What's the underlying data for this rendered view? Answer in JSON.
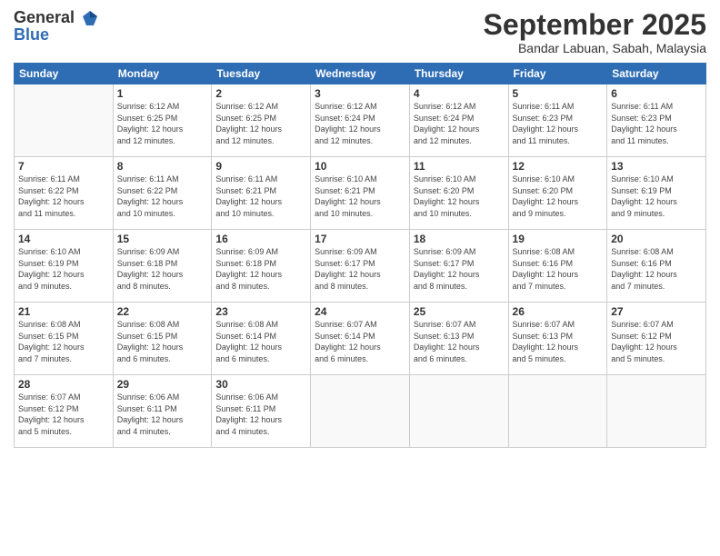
{
  "header": {
    "logo_general": "General",
    "logo_blue": "Blue",
    "month_title": "September 2025",
    "subtitle": "Bandar Labuan, Sabah, Malaysia"
  },
  "days_of_week": [
    "Sunday",
    "Monday",
    "Tuesday",
    "Wednesday",
    "Thursday",
    "Friday",
    "Saturday"
  ],
  "weeks": [
    [
      {
        "day": "",
        "info": ""
      },
      {
        "day": "1",
        "info": "Sunrise: 6:12 AM\nSunset: 6:25 PM\nDaylight: 12 hours\nand 12 minutes."
      },
      {
        "day": "2",
        "info": "Sunrise: 6:12 AM\nSunset: 6:25 PM\nDaylight: 12 hours\nand 12 minutes."
      },
      {
        "day": "3",
        "info": "Sunrise: 6:12 AM\nSunset: 6:24 PM\nDaylight: 12 hours\nand 12 minutes."
      },
      {
        "day": "4",
        "info": "Sunrise: 6:12 AM\nSunset: 6:24 PM\nDaylight: 12 hours\nand 12 minutes."
      },
      {
        "day": "5",
        "info": "Sunrise: 6:11 AM\nSunset: 6:23 PM\nDaylight: 12 hours\nand 11 minutes."
      },
      {
        "day": "6",
        "info": "Sunrise: 6:11 AM\nSunset: 6:23 PM\nDaylight: 12 hours\nand 11 minutes."
      }
    ],
    [
      {
        "day": "7",
        "info": "Sunrise: 6:11 AM\nSunset: 6:22 PM\nDaylight: 12 hours\nand 11 minutes."
      },
      {
        "day": "8",
        "info": "Sunrise: 6:11 AM\nSunset: 6:22 PM\nDaylight: 12 hours\nand 10 minutes."
      },
      {
        "day": "9",
        "info": "Sunrise: 6:11 AM\nSunset: 6:21 PM\nDaylight: 12 hours\nand 10 minutes."
      },
      {
        "day": "10",
        "info": "Sunrise: 6:10 AM\nSunset: 6:21 PM\nDaylight: 12 hours\nand 10 minutes."
      },
      {
        "day": "11",
        "info": "Sunrise: 6:10 AM\nSunset: 6:20 PM\nDaylight: 12 hours\nand 10 minutes."
      },
      {
        "day": "12",
        "info": "Sunrise: 6:10 AM\nSunset: 6:20 PM\nDaylight: 12 hours\nand 9 minutes."
      },
      {
        "day": "13",
        "info": "Sunrise: 6:10 AM\nSunset: 6:19 PM\nDaylight: 12 hours\nand 9 minutes."
      }
    ],
    [
      {
        "day": "14",
        "info": "Sunrise: 6:10 AM\nSunset: 6:19 PM\nDaylight: 12 hours\nand 9 minutes."
      },
      {
        "day": "15",
        "info": "Sunrise: 6:09 AM\nSunset: 6:18 PM\nDaylight: 12 hours\nand 8 minutes."
      },
      {
        "day": "16",
        "info": "Sunrise: 6:09 AM\nSunset: 6:18 PM\nDaylight: 12 hours\nand 8 minutes."
      },
      {
        "day": "17",
        "info": "Sunrise: 6:09 AM\nSunset: 6:17 PM\nDaylight: 12 hours\nand 8 minutes."
      },
      {
        "day": "18",
        "info": "Sunrise: 6:09 AM\nSunset: 6:17 PM\nDaylight: 12 hours\nand 8 minutes."
      },
      {
        "day": "19",
        "info": "Sunrise: 6:08 AM\nSunset: 6:16 PM\nDaylight: 12 hours\nand 7 minutes."
      },
      {
        "day": "20",
        "info": "Sunrise: 6:08 AM\nSunset: 6:16 PM\nDaylight: 12 hours\nand 7 minutes."
      }
    ],
    [
      {
        "day": "21",
        "info": "Sunrise: 6:08 AM\nSunset: 6:15 PM\nDaylight: 12 hours\nand 7 minutes."
      },
      {
        "day": "22",
        "info": "Sunrise: 6:08 AM\nSunset: 6:15 PM\nDaylight: 12 hours\nand 6 minutes."
      },
      {
        "day": "23",
        "info": "Sunrise: 6:08 AM\nSunset: 6:14 PM\nDaylight: 12 hours\nand 6 minutes."
      },
      {
        "day": "24",
        "info": "Sunrise: 6:07 AM\nSunset: 6:14 PM\nDaylight: 12 hours\nand 6 minutes."
      },
      {
        "day": "25",
        "info": "Sunrise: 6:07 AM\nSunset: 6:13 PM\nDaylight: 12 hours\nand 6 minutes."
      },
      {
        "day": "26",
        "info": "Sunrise: 6:07 AM\nSunset: 6:13 PM\nDaylight: 12 hours\nand 5 minutes."
      },
      {
        "day": "27",
        "info": "Sunrise: 6:07 AM\nSunset: 6:12 PM\nDaylight: 12 hours\nand 5 minutes."
      }
    ],
    [
      {
        "day": "28",
        "info": "Sunrise: 6:07 AM\nSunset: 6:12 PM\nDaylight: 12 hours\nand 5 minutes."
      },
      {
        "day": "29",
        "info": "Sunrise: 6:06 AM\nSunset: 6:11 PM\nDaylight: 12 hours\nand 4 minutes."
      },
      {
        "day": "30",
        "info": "Sunrise: 6:06 AM\nSunset: 6:11 PM\nDaylight: 12 hours\nand 4 minutes."
      },
      {
        "day": "",
        "info": ""
      },
      {
        "day": "",
        "info": ""
      },
      {
        "day": "",
        "info": ""
      },
      {
        "day": "",
        "info": ""
      }
    ]
  ]
}
